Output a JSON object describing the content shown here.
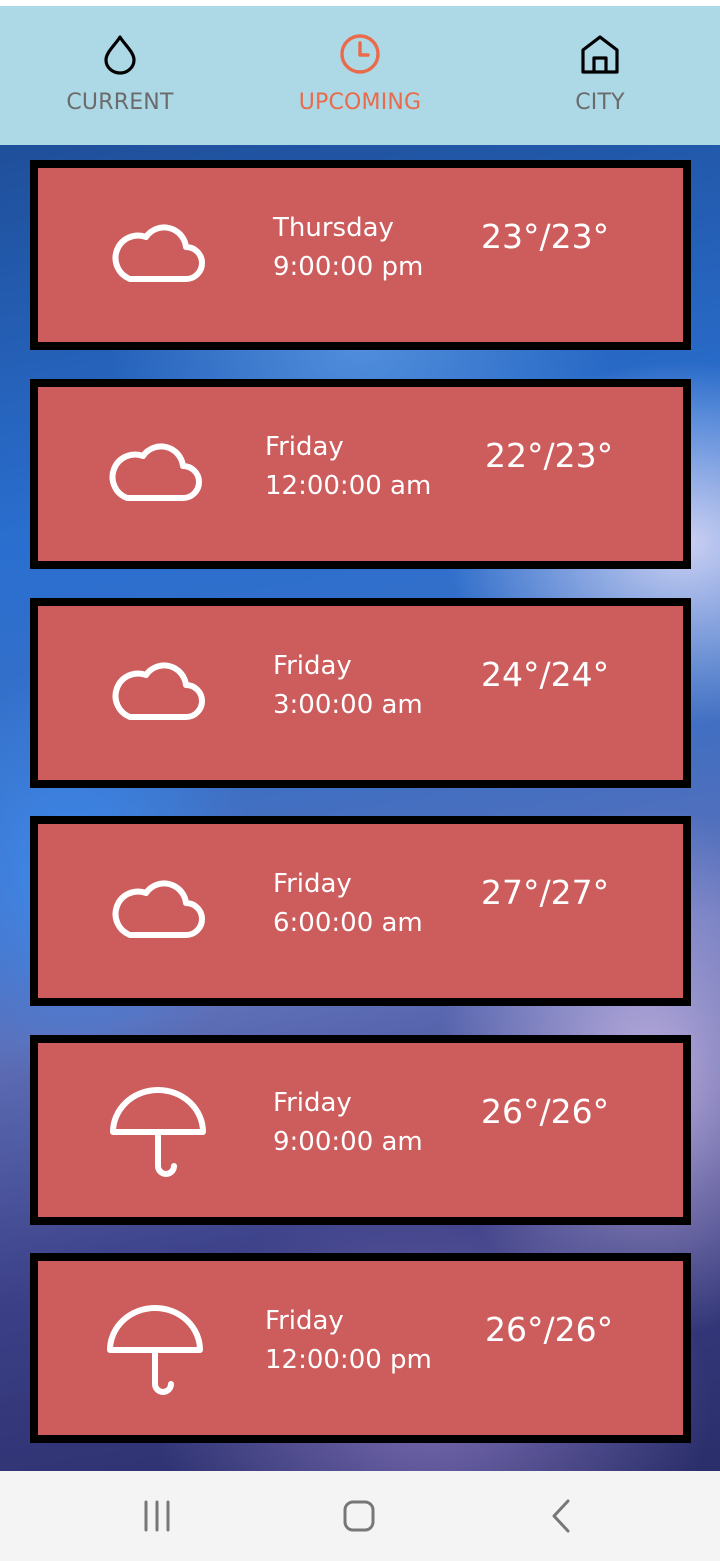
{
  "tabs": [
    {
      "label": "CURRENT",
      "icon": "water-drop-icon",
      "active": false
    },
    {
      "label": "UPCOMING",
      "icon": "clock-icon",
      "active": true
    },
    {
      "label": "CITY",
      "icon": "home-icon",
      "active": false
    }
  ],
  "colors": {
    "tabbar_bg": "#add8e6",
    "active_tab": "#ea6a4a",
    "inactive_tab": "#6b6b6b",
    "indicator": "#1e74e0",
    "card_bg": "#cd5c5c",
    "card_border": "#000000"
  },
  "forecast": [
    {
      "icon": "cloud-icon",
      "day": "Thursday",
      "time": "9:00:00 pm",
      "temp": "23°/23°"
    },
    {
      "icon": "cloud-icon",
      "day": "Friday",
      "time": "12:00:00 am",
      "temp": "22°/23°"
    },
    {
      "icon": "cloud-icon",
      "day": "Friday",
      "time": "3:00:00 am",
      "temp": "24°/24°"
    },
    {
      "icon": "cloud-icon",
      "day": "Friday",
      "time": "6:00:00 am",
      "temp": "27°/27°"
    },
    {
      "icon": "umbrella-icon",
      "day": "Friday",
      "time": "9:00:00 am",
      "temp": "26°/26°"
    },
    {
      "icon": "umbrella-icon",
      "day": "Friday",
      "time": "12:00:00 pm",
      "temp": "26°/26°"
    }
  ],
  "system_nav": {
    "recents": "recent-apps-icon",
    "home": "home-button-icon",
    "back": "back-icon"
  }
}
